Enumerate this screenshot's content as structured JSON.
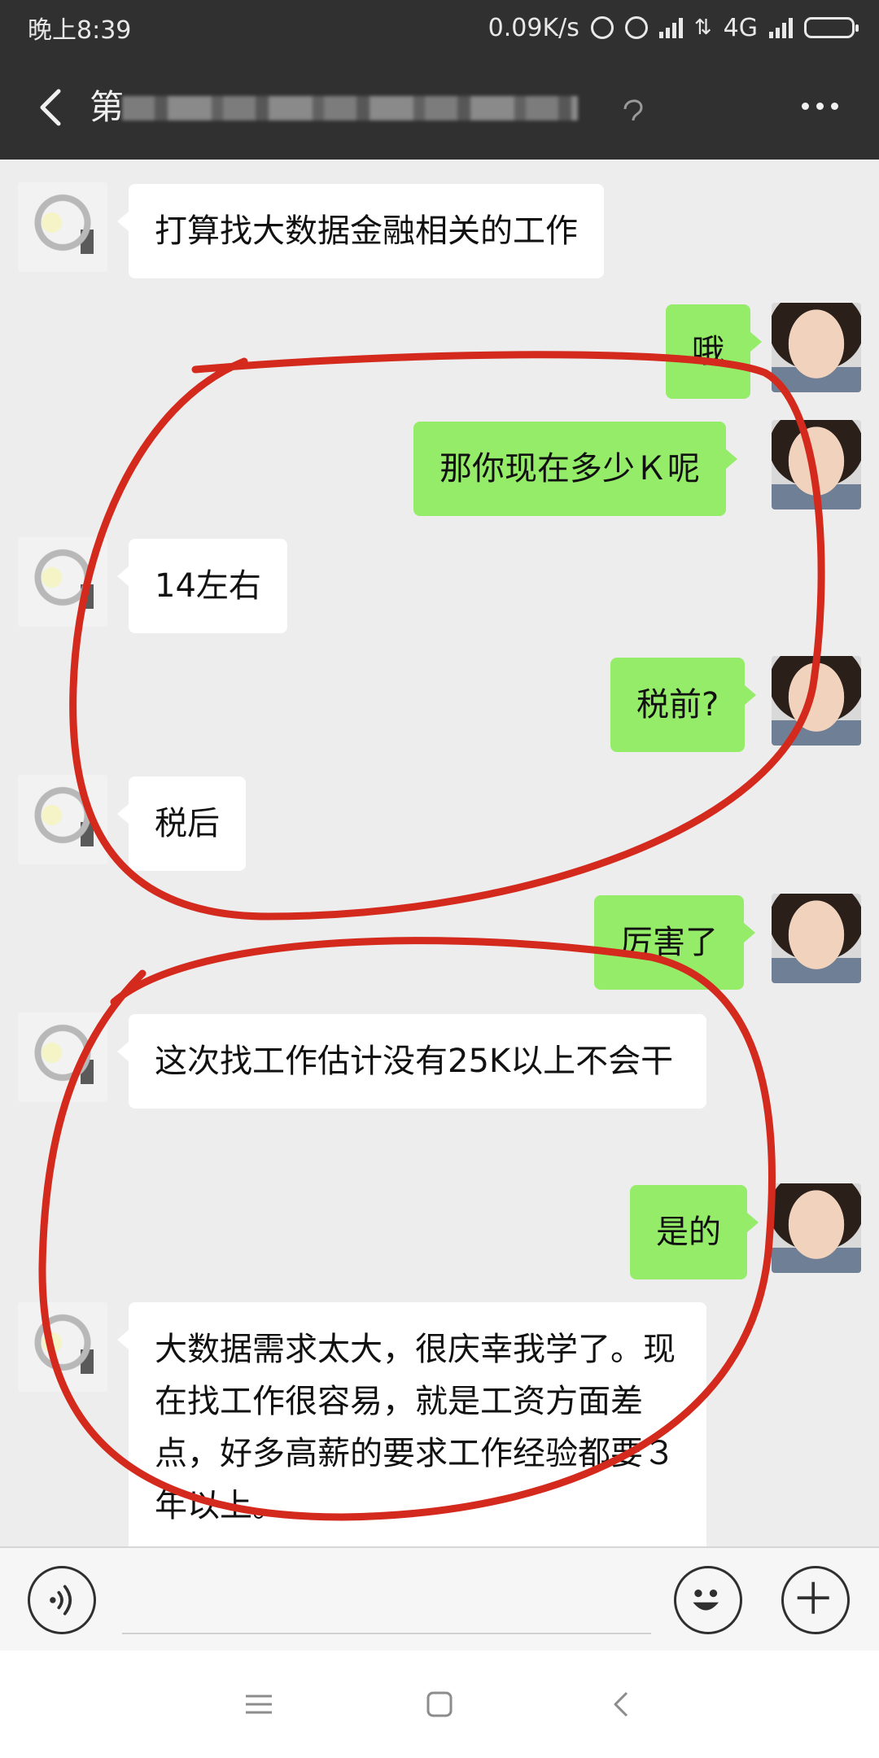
{
  "status_bar": {
    "time": "晚上8:39",
    "net_speed": "0.09K/s",
    "network": "4G"
  },
  "header": {
    "title_visible_char": "第",
    "icons": [
      "back-icon",
      "ear-icon",
      "more-icon"
    ]
  },
  "messages": [
    {
      "side": "left",
      "text": "打算找大数据金融相关的工作"
    },
    {
      "side": "right",
      "text": "哦"
    },
    {
      "side": "right",
      "text": "那你现在多少Ｋ呢"
    },
    {
      "side": "left",
      "text": "14左右"
    },
    {
      "side": "right",
      "text": "税前?"
    },
    {
      "side": "left",
      "text": "税后"
    },
    {
      "side": "right",
      "text": "厉害了"
    },
    {
      "side": "left",
      "text": "这次找工作估计没有25K以上不会干"
    },
    {
      "side": "right",
      "text": "是的"
    },
    {
      "side": "left",
      "text": "大数据需求太大，很庆幸我学了。现在找工作很容易，就是工资方面差点，好多高薪的要求工作经验都要３年以上。"
    }
  ],
  "input_bar": {
    "placeholder": "",
    "icons": [
      "voice-icon",
      "emoji-icon",
      "plus-icon"
    ]
  },
  "nav_bar": {
    "icons": [
      "menu-icon",
      "home-icon",
      "back-nav-icon"
    ]
  },
  "colors": {
    "header_bg": "#303030",
    "chat_bg": "#ededed",
    "sent_bubble": "#95ec69",
    "received_bubble": "#ffffff",
    "annotation_red": "#d42a1e"
  }
}
